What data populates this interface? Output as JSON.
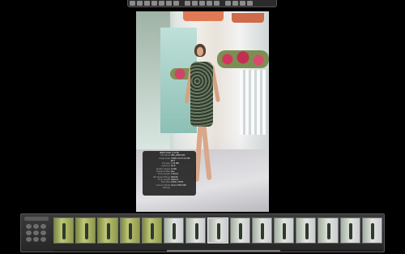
{
  "toolbar": {
    "buttons": [
      {
        "icon": "rotate-left-icon"
      },
      {
        "icon": "rotate-right-icon"
      },
      {
        "icon": "crop-icon"
      },
      {
        "icon": "straighten-icon"
      },
      {
        "icon": "loupe-icon"
      },
      {
        "icon": "adjust-icon"
      },
      {
        "icon": "lift-icon"
      },
      {
        "icon": "stamp-icon"
      },
      {
        "icon": "select-icon"
      },
      {
        "icon": "zoom-icon"
      },
      {
        "icon": "redeye-icon"
      },
      {
        "icon": "spot-icon"
      },
      {
        "icon": "view-icon"
      },
      {
        "icon": "info-icon"
      },
      {
        "icon": "hud-icon"
      },
      {
        "icon": "fullscreen-icon"
      }
    ]
  },
  "hud": {
    "title": "Batch Color 3 of 36",
    "rows": [
      {
        "k": "File Name",
        "v": "IMG_0348.CR2"
      },
      {
        "k": "Image Date",
        "v": "7/8/04 12:57:23 PM EDT"
      },
      {
        "k": "File Size",
        "v": "7.34 MB"
      },
      {
        "k": "Aperture",
        "v": "f/2.8"
      },
      {
        "k": "Shutter Speed",
        "v": "1/500"
      },
      {
        "k": "Exposure Bias",
        "v": "0ev"
      },
      {
        "k": "Focal Length",
        "v": "170mm"
      },
      {
        "k": "ISO Speed Rating",
        "v": "ISO100"
      },
      {
        "k": "Focal Length",
        "v": "200mm"
      },
      {
        "k": "Pixel Size",
        "v": "2336 x 3504"
      },
      {
        "k": "Camera Model",
        "v": "Canon EOS 20D"
      },
      {
        "k": "Ratings",
        "v": ""
      }
    ]
  },
  "filmstrip": {
    "control_label": "",
    "thumbs": [
      {
        "style": "green",
        "label": ""
      },
      {
        "style": "green",
        "label": ""
      },
      {
        "style": "green",
        "label": ""
      },
      {
        "style": "green",
        "label": ""
      },
      {
        "style": "green",
        "label": ""
      },
      {
        "style": "",
        "label": ""
      },
      {
        "style": "",
        "label": ""
      },
      {
        "style": "selected",
        "label": ""
      },
      {
        "style": "",
        "label": ""
      },
      {
        "style": "",
        "label": ""
      },
      {
        "style": "",
        "label": ""
      },
      {
        "style": "",
        "label": ""
      },
      {
        "style": "",
        "label": ""
      },
      {
        "style": "",
        "label": ""
      },
      {
        "style": "",
        "label": ""
      }
    ]
  }
}
